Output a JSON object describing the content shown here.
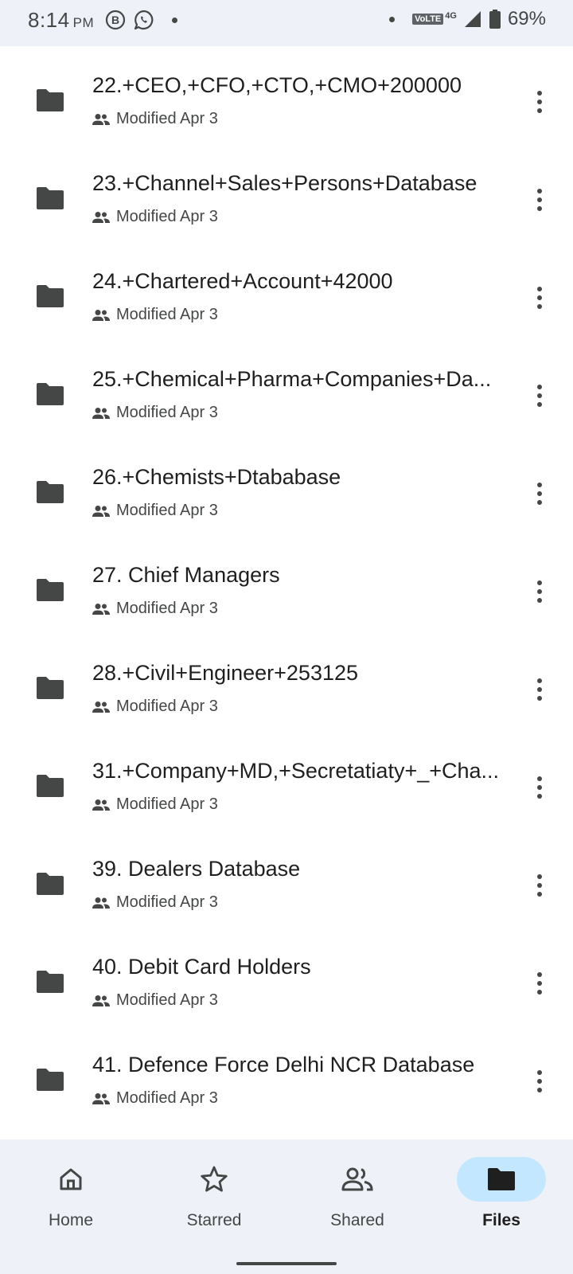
{
  "status_bar": {
    "time": "8:14",
    "ampm": "PM",
    "volte": "VoLTE",
    "network": "4G",
    "battery": "69%"
  },
  "files": [
    {
      "name": "22.+CEO,+CFO,+CTO,+CMO+200000",
      "meta": "Modified Apr 3"
    },
    {
      "name": "23.+Channel+Sales+Persons+Database",
      "meta": "Modified Apr 3"
    },
    {
      "name": "24.+Chartered+Account+42000",
      "meta": "Modified Apr 3"
    },
    {
      "name": "25.+Chemical+Pharma+Companies+Da...",
      "meta": "Modified Apr 3"
    },
    {
      "name": "26.+Chemists+Dtababase",
      "meta": "Modified Apr 3"
    },
    {
      "name": "27. Chief Managers",
      "meta": "Modified Apr 3"
    },
    {
      "name": "28.+Civil+Engineer+253125",
      "meta": "Modified Apr 3"
    },
    {
      "name": "31.+Company+MD,+Secretatiaty+_+Cha...",
      "meta": "Modified Apr 3"
    },
    {
      "name": "39. Dealers Database",
      "meta": "Modified Apr 3"
    },
    {
      "name": "40. Debit Card Holders",
      "meta": "Modified Apr 3"
    },
    {
      "name": "41. Defence Force Delhi NCR Database",
      "meta": "Modified Apr 3"
    }
  ],
  "nav": {
    "home": "Home",
    "starred": "Starred",
    "shared": "Shared",
    "files": "Files",
    "active": "files"
  },
  "colors": {
    "accent": "#c2e7ff",
    "surface": "#eef1f8",
    "icon": "#444746"
  }
}
